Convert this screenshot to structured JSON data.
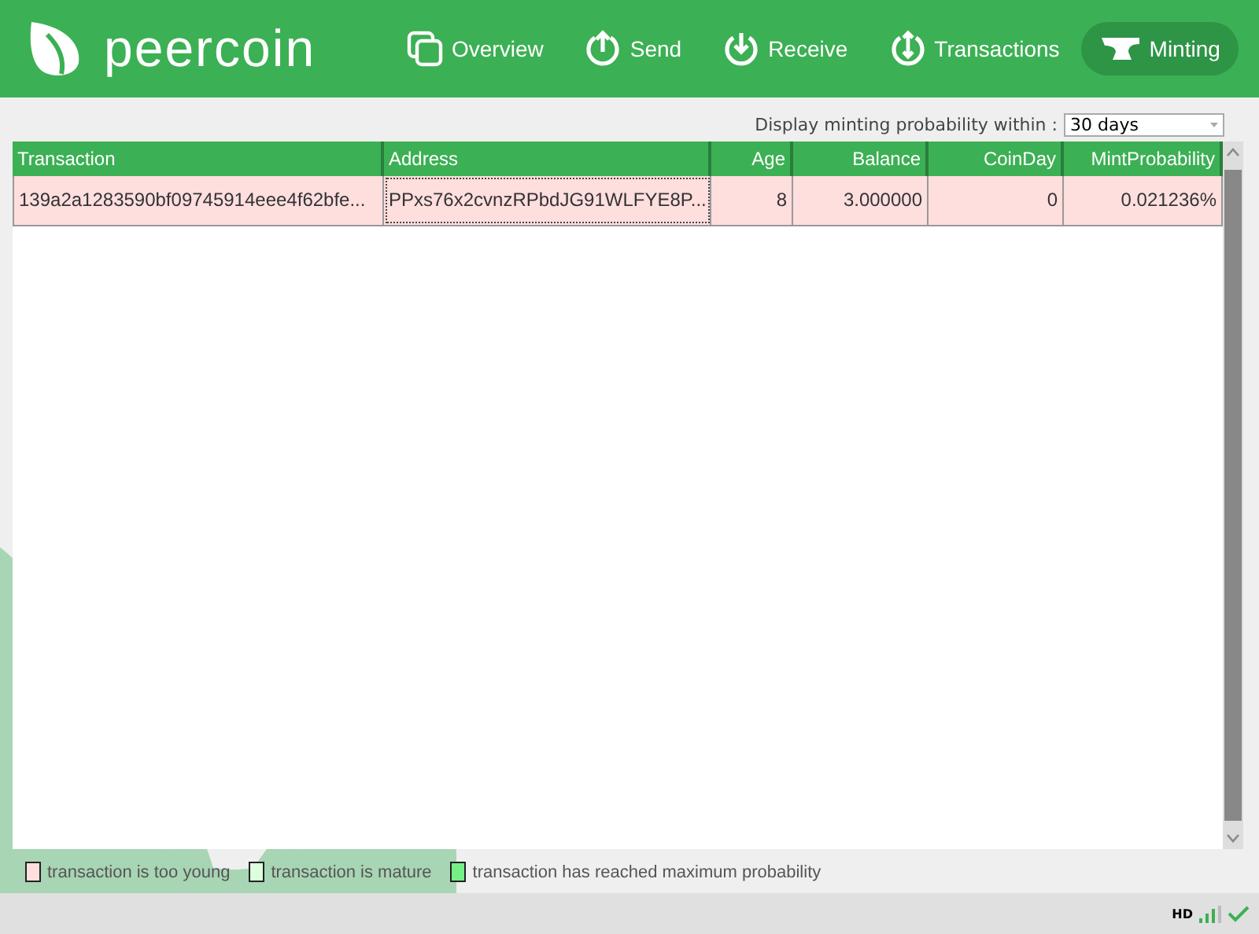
{
  "header": {
    "logo": "peercoin",
    "tabs": [
      {
        "label": "Overview",
        "selected": false
      },
      {
        "label": "Send",
        "selected": false
      },
      {
        "label": "Receive",
        "selected": false
      },
      {
        "label": "Transactions",
        "selected": false
      },
      {
        "label": "Minting",
        "selected": true
      }
    ]
  },
  "probability": {
    "label": "Display minting probability within :",
    "value": "30 days"
  },
  "table": {
    "columns": [
      "Transaction",
      "Address",
      "Age",
      "Balance",
      "CoinDay",
      "MintProbability"
    ],
    "rows": [
      {
        "color": "#ffdede",
        "cells": [
          "139a2a1283590bf09745914eee4f62bfe...",
          "PPxs76x2cvnzRPbdJG91WLFYE8P...",
          "8",
          "3.000000",
          "0",
          "0.021236%"
        ]
      }
    ]
  },
  "legend": [
    {
      "color": "#ffdede",
      "label": "transaction is too young"
    },
    {
      "color": "#ddffdd",
      "label": "transaction is mature"
    },
    {
      "color": "#77ee88",
      "label": "transaction has reached maximum probability"
    }
  ],
  "status_bar": {
    "hd": "HD"
  }
}
